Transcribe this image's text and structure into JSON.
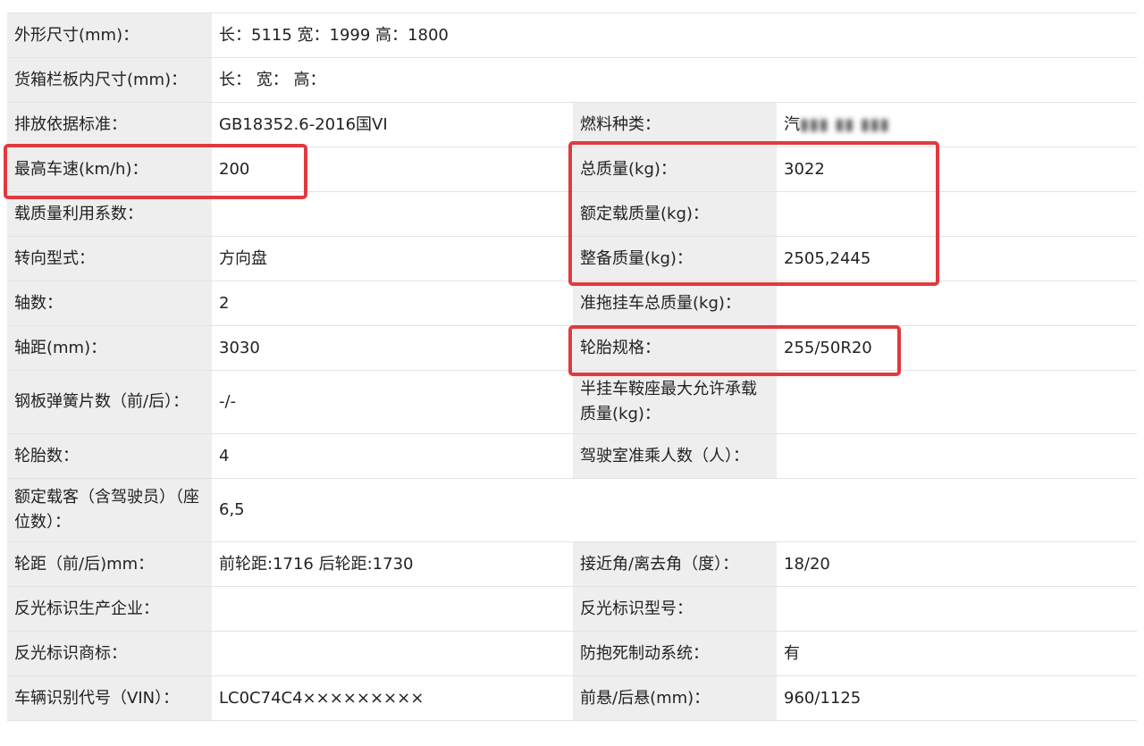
{
  "rows": [
    {
      "type": "full",
      "label": "外形尺寸(mm)：",
      "value": "长：5115 宽：1999 高：1800"
    },
    {
      "type": "full",
      "label": "货箱栏板内尺寸(mm)：",
      "value": "长： 宽： 高："
    },
    {
      "type": "pair",
      "label1": "排放依据标准：",
      "value1": "GB18352.6-2016国VI",
      "label2": "燃料种类：",
      "value2": "汽"
    },
    {
      "type": "pair",
      "label1": "最高车速(km/h)：",
      "value1": "200",
      "label2": "总质量(kg)：",
      "value2": "3022"
    },
    {
      "type": "pair",
      "label1": "载质量利用系数：",
      "value1": "",
      "label2": "额定载质量(kg)：",
      "value2": ""
    },
    {
      "type": "pair",
      "label1": "转向型式：",
      "value1": "方向盘",
      "label2": "整备质量(kg)：",
      "value2": "2505,2445"
    },
    {
      "type": "pair",
      "label1": "轴数：",
      "value1": "2",
      "label2": "准拖挂车总质量(kg)：",
      "value2": ""
    },
    {
      "type": "pair",
      "label1": "轴距(mm)：",
      "value1": "3030",
      "label2": "轮胎规格：",
      "value2": "255/50R20"
    },
    {
      "type": "pair",
      "label1": "钢板弹簧片数（前/后）：",
      "value1": "-/-",
      "label2": "半挂车鞍座最大允许承载质量(kg)：",
      "value2": ""
    },
    {
      "type": "pair",
      "label1": "轮胎数：",
      "value1": "4",
      "label2": "驾驶室准乘人数（人）：",
      "value2": ""
    },
    {
      "type": "full",
      "label": "额定载客（含驾驶员）（座位数）：",
      "value": "6,5"
    },
    {
      "type": "pair",
      "label1": "轮距（前/后)mm：",
      "value1": "前轮距:1716 后轮距:1730",
      "label2": "接近角/离去角（度）：",
      "value2": "18/20"
    },
    {
      "type": "pair",
      "label1": "反光标识生产企业：",
      "value1": "",
      "label2": "反光标识型号：",
      "value2": ""
    },
    {
      "type": "pair",
      "label1": "反光标识商标：",
      "value1": "",
      "label2": "防抱死制动系统：",
      "value2": "有"
    },
    {
      "type": "pair",
      "label1": "车辆识别代号（VIN）：",
      "value1": "LC0C74C4×××××××××",
      "label2": "前悬/后悬(mm)：",
      "value2": "960/1125"
    }
  ]
}
